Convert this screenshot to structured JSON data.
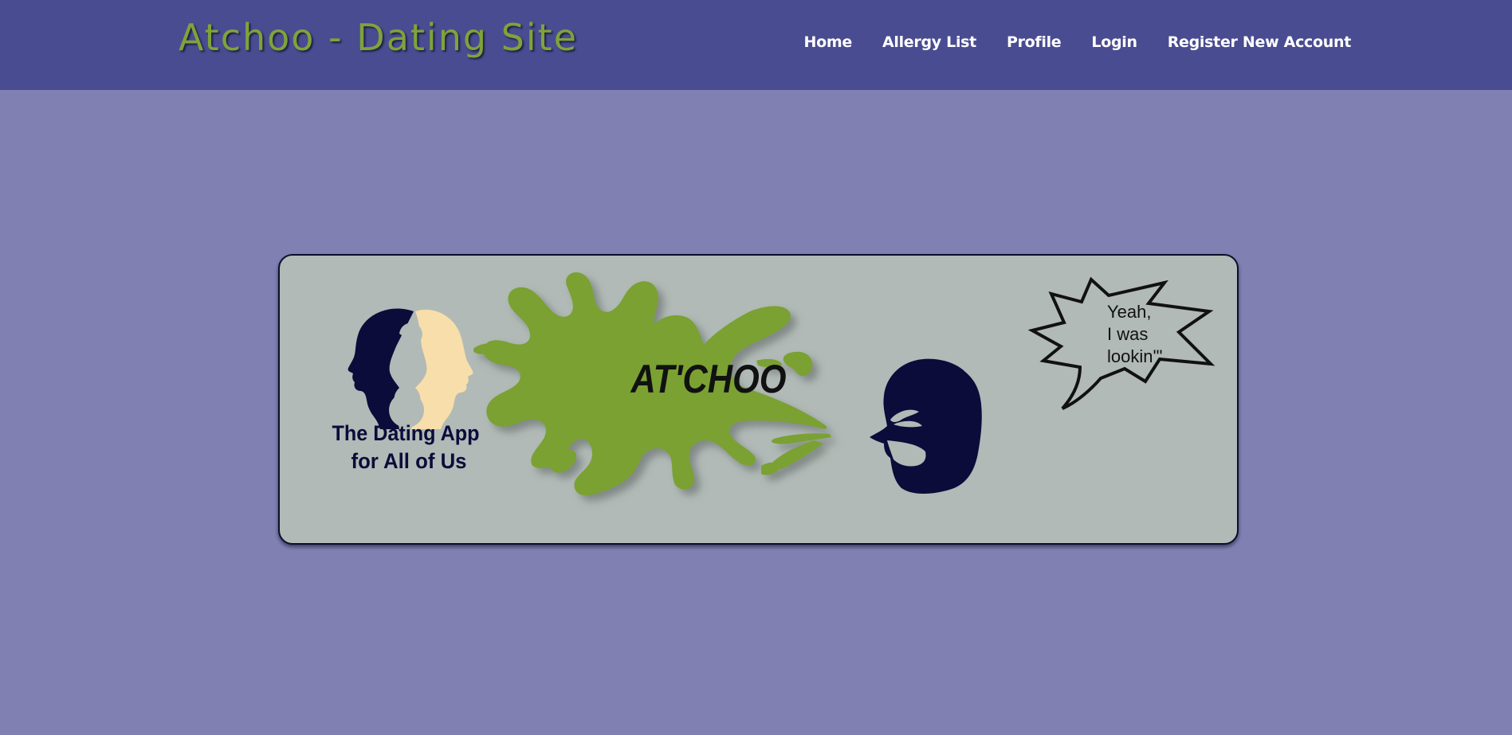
{
  "header": {
    "title": "Atchoo - Dating Site",
    "nav": [
      {
        "label": "Home"
      },
      {
        "label": "Allergy List"
      },
      {
        "label": "Profile"
      },
      {
        "label": "Login"
      },
      {
        "label": "Register New Account"
      }
    ]
  },
  "banner": {
    "tagline_line1": "The Dating App",
    "tagline_line2": "for All of Us",
    "splat_text": "AT'CHOO",
    "speech_line1": "Yeah,",
    "speech_line2": "I was",
    "speech_line3": "lookin'\""
  },
  "colors": {
    "header_bg": "#4a4c91",
    "page_bg": "#8080b3",
    "title_green": "#7fa33b",
    "banner_bg": "#b1bab6",
    "navy": "#0b0c3a",
    "cream": "#f8deab"
  }
}
